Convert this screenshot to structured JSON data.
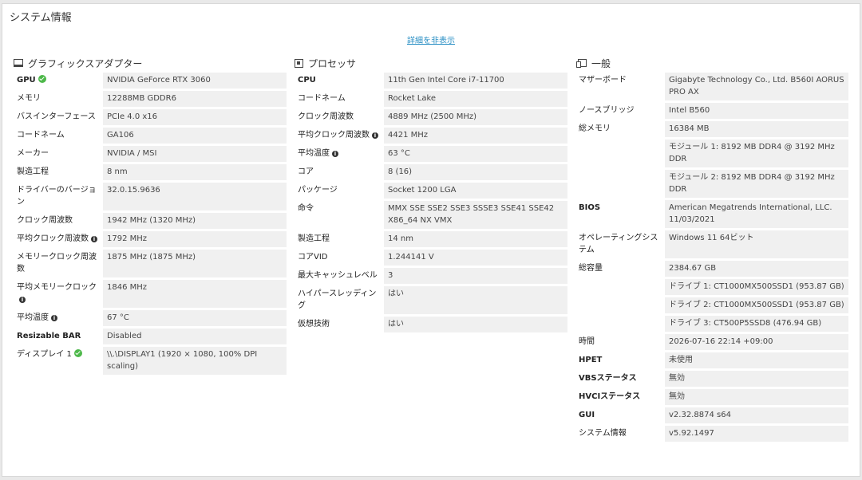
{
  "title": "システム情報",
  "toggle_label": "詳細を非表示",
  "gpu": {
    "header": "グラフィックスアダプター",
    "rows": [
      {
        "label": "GPU",
        "value": "NVIDIA GeForce RTX 3060",
        "bold": true,
        "icon": "check"
      },
      {
        "label": "メモリ",
        "value": "12288MB GDDR6"
      },
      {
        "label": "バスインターフェース",
        "value": "PCIe 4.0 x16"
      },
      {
        "label": "コードネーム",
        "value": "GA106"
      },
      {
        "label": "メーカー",
        "value": "NVIDIA / MSI"
      },
      {
        "label": "製造工程",
        "value": "8 nm"
      },
      {
        "label": "ドライバーのバージョン",
        "value": "32.0.15.9636"
      },
      {
        "label": "クロック周波数",
        "value": "1942 MHz (1320 MHz)"
      },
      {
        "label": "平均クロック周波数",
        "value": "1792 MHz",
        "icon": "info"
      },
      {
        "label": "メモリークロック周波数",
        "value": "1875 MHz (1875 MHz)"
      },
      {
        "label": "平均メモリークロック",
        "value": "1846 MHz",
        "icon": "info"
      },
      {
        "label": "平均温度",
        "value": "67 °C",
        "icon": "info"
      },
      {
        "label": "Resizable BAR",
        "value": "Disabled",
        "bold": true
      },
      {
        "label": "ディスプレイ 1",
        "value": "\\\\.\\DISPLAY1 (1920 × 1080, 100% DPI scaling)",
        "icon": "check"
      }
    ]
  },
  "cpu": {
    "header": "プロセッサ",
    "rows": [
      {
        "label": "CPU",
        "value": "11th Gen Intel Core i7-11700",
        "bold": true
      },
      {
        "label": "コードネーム",
        "value": "Rocket Lake"
      },
      {
        "label": "クロック周波数",
        "value": "4889 MHz (2500 MHz)"
      },
      {
        "label": "平均クロック周波数",
        "value": "4421 MHz",
        "icon": "info"
      },
      {
        "label": "平均温度",
        "value": "63 °C",
        "icon": "info"
      },
      {
        "label": "コア",
        "value": "8 (16)"
      },
      {
        "label": "パッケージ",
        "value": "Socket 1200 LGA"
      },
      {
        "label": "命令",
        "value": "MMX SSE SSE2 SSE3 SSSE3 SSE41 SSE42 X86_64 NX VMX"
      },
      {
        "label": "製造工程",
        "value": "14 nm"
      },
      {
        "label": "コアVID",
        "value": "1.244141 V"
      },
      {
        "label": "最大キャッシュレベル",
        "value": "3"
      },
      {
        "label": "ハイパースレッディング",
        "value": "はい"
      },
      {
        "label": "仮想技術",
        "value": "はい"
      }
    ]
  },
  "general": {
    "header": "一般",
    "rows": [
      {
        "label": "マザーボード",
        "value": "Gigabyte Technology Co., Ltd. B560I AORUS PRO AX"
      },
      {
        "label": "ノースブリッジ",
        "value": "Intel B560"
      },
      {
        "label": "総メモリ",
        "value": "16384 MB"
      },
      {
        "label": "",
        "value": "モジュール 1: 8192 MB DDR4 @ 3192 MHz DDR"
      },
      {
        "label": "",
        "value": "モジュール 2: 8192 MB DDR4 @ 3192 MHz DDR"
      },
      {
        "label": "BIOS",
        "value": "American Megatrends International, LLC. 11/03/2021",
        "bold": true
      },
      {
        "label": "オペレーティングシステム",
        "value": "Windows 11 64ビット"
      },
      {
        "label": "総容量",
        "value": "2384.67 GB"
      },
      {
        "label": "",
        "value": "ドライブ 1: CT1000MX500SSD1 (953.87 GB)"
      },
      {
        "label": "",
        "value": "ドライブ 2: CT1000MX500SSD1 (953.87 GB)"
      },
      {
        "label": "",
        "value": "ドライブ 3: CT500P5SSD8 (476.94 GB)"
      },
      {
        "label": "時間",
        "value": "2026-07-16 22:14 +09:00"
      },
      {
        "label": "HPET",
        "value": "未使用",
        "bold": true
      },
      {
        "label": "VBSステータス",
        "value": "無効",
        "bold": true
      },
      {
        "label": "HVCIステータス",
        "value": "無効",
        "bold": true
      },
      {
        "label": "GUI",
        "value": "v2.32.8874 s64",
        "bold": true
      },
      {
        "label": "システム情報",
        "value": "v5.92.1497"
      }
    ]
  }
}
